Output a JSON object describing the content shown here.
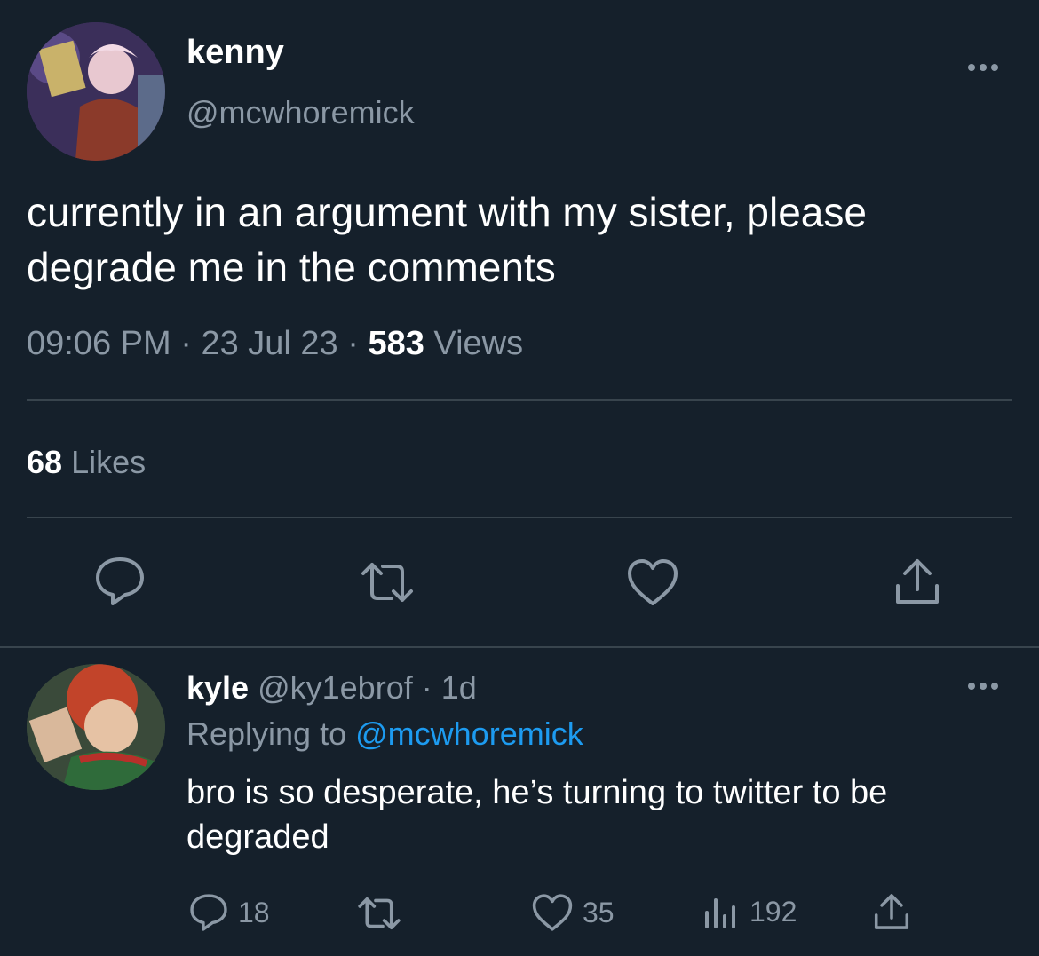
{
  "tweet": {
    "author": {
      "name": "kenny",
      "handle": "@mcwhoremick"
    },
    "text": "currently in an argument with my sister, please degrade me in the comments",
    "time": "09:06 PM",
    "date": "23 Jul 23",
    "views_count": "583",
    "views_label": "Views",
    "likes_count": "68",
    "likes_label": "Likes"
  },
  "reply": {
    "author": {
      "name": "kyle",
      "handle": "@ky1ebrof",
      "age": "1d"
    },
    "replying_prefix": "Replying to",
    "replying_to": "@mcwhoremick",
    "text": "bro is so desperate, he’s turning to twitter to be degraded",
    "reply_count": "18",
    "like_count": "35",
    "view_count": "192"
  },
  "separator": "·",
  "colors": {
    "background": "#15202b",
    "muted_text": "#8b98a5",
    "divider": "#38444d",
    "link": "#1d9bf0"
  },
  "icons": [
    "more-icon",
    "reply-icon",
    "retweet-icon",
    "like-icon",
    "share-icon",
    "views-icon"
  ]
}
